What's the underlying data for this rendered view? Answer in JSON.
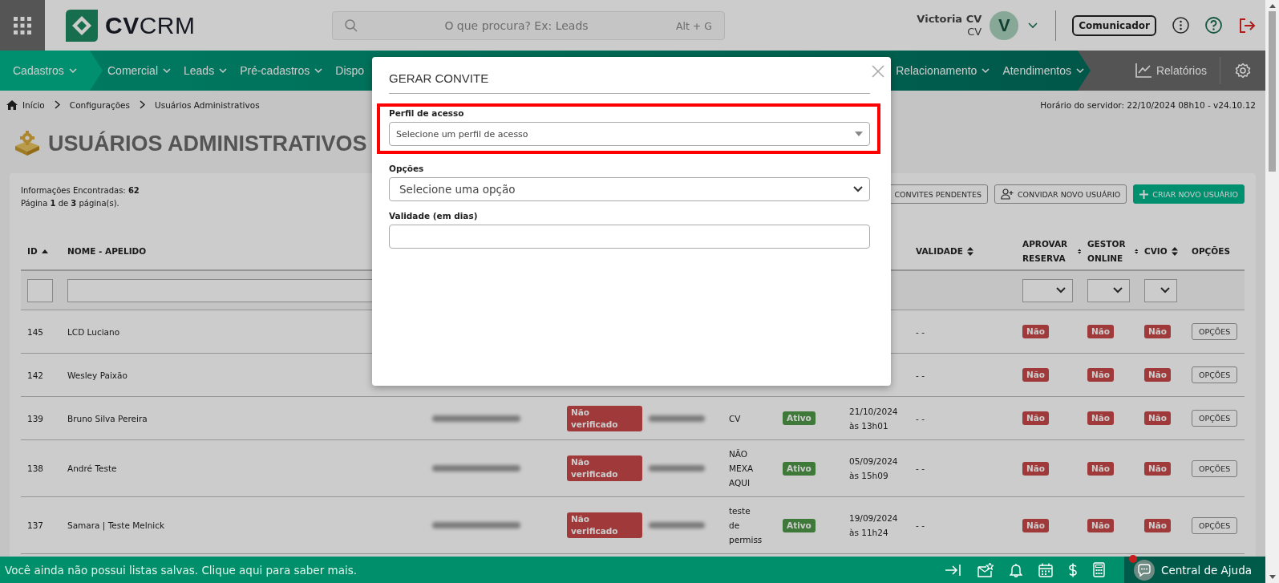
{
  "header": {
    "logo": "**CV**CRM",
    "search": {
      "placeholder": "O que procura? Ex: Leads",
      "shortcut": "Alt + G"
    },
    "user": {
      "name": "Victoria CV",
      "role": "CV",
      "initial": "V"
    },
    "communicator": "Comunicador"
  },
  "nav": {
    "primary": {
      "label": "Cadastros",
      "caret": true
    },
    "left_items": [
      {
        "label": "Comercial",
        "caret": true
      },
      {
        "label": "Leads",
        "caret": true
      },
      {
        "label": "Pré-cadastros",
        "caret": true
      },
      {
        "label": "Dispo",
        "caret": false
      }
    ],
    "right_items": [
      {
        "label": "Relacionamento",
        "caret": true
      },
      {
        "label": "Atendimentos",
        "caret": true
      }
    ],
    "reports": "Relatórios"
  },
  "breadcrumb": {
    "items": [
      "Início",
      "Configurações",
      "Usuários Administrativos"
    ],
    "server_time": "Horário do servidor: 22/10/2024 08h10 - v24.10.12"
  },
  "page_title": "USUÁRIOS ADMINISTRATIVOS",
  "summary": [
    "Informações Encontradas: **62**",
    "Página **1** de **3** página(s)."
  ],
  "actions": [
    {
      "label": "CONVITES PENDENTES",
      "kind": "plain"
    },
    {
      "label": "CONVIDAR NOVO USUÁRIO",
      "kind": "invite"
    },
    {
      "label": "CRIAR NOVO USUÁRIO",
      "kind": "create"
    }
  ],
  "table": {
    "columns": [
      {
        "label": "ID",
        "kind": "text-filter",
        "sortable": true,
        "sorted": true
      },
      {
        "label": "NOME - APELIDO",
        "kind": "text-filter",
        "sortable": false,
        "sorted": false
      },
      {
        "label": "VALIDADE",
        "kind": "no-filter",
        "sortable": true,
        "sorted": false
      },
      {
        "label": "APROVAR RESERVA",
        "kind": "select-filter",
        "sortable": true,
        "sorted": false
      },
      {
        "label": "GESTOR ONLINE",
        "kind": "select-filter",
        "sortable": true,
        "sorted": false
      },
      {
        "label": "CVIO",
        "kind": "select-filter",
        "sortable": true,
        "sorted": false
      },
      {
        "label": "OPÇÕES",
        "kind": "no-filter",
        "sortable": false,
        "sorted": false
      }
    ],
    "rows": [
      {
        "id": "145",
        "name": "LCD Luciano",
        "validity": "- -",
        "approve": "Não",
        "manager": "Não",
        "cvio": "Não",
        "action": "OPÇÕES"
      },
      {
        "id": "142",
        "name": "Wesley Paixão",
        "validity": "- -",
        "approve": "Não",
        "manager": "Não",
        "cvio": "Não",
        "action": "OPÇÕES"
      },
      {
        "id": "139",
        "name": "Bruno Silva Pereira",
        "email_blurred": true,
        "status": "Não verificado",
        "phone_blurred": true,
        "profile": "CV",
        "situation": "Ativo",
        "date": "21/10/2024",
        "time": "às 13h01",
        "validity": "- -",
        "approve": "Não",
        "manager": "Não",
        "cvio": "Não",
        "action": "OPÇÕES"
      },
      {
        "id": "138",
        "name": "André Teste",
        "email_blurred": true,
        "status": "Não verificado",
        "phone_blurred": true,
        "profile": "NÃO MEXA AQUI",
        "situation": "Ativo",
        "date": "05/09/2024",
        "time": "às 15h09",
        "validity": "- -",
        "approve": "Não",
        "manager": "Não",
        "cvio": "Não",
        "action": "OPÇÕES"
      },
      {
        "id": "137",
        "name": "Samara | Teste Melnick",
        "email_blurred": true,
        "status": "Não verificado",
        "phone_blurred": true,
        "profile": "teste de permiss",
        "situation": "Ativo",
        "date": "19/09/2024",
        "time": "às 11h24",
        "validity": "- -",
        "approve": "Não",
        "manager": "Não",
        "cvio": "Não",
        "action": "OPÇÕES"
      }
    ]
  },
  "modal": {
    "title": "GERAR CONVITE",
    "fields": [
      {
        "label": "Perfil de acesso",
        "kind": "select2",
        "placeholder": "Selecione um perfil de acesso",
        "highlighted": true
      },
      {
        "label": "Opções",
        "kind": "select",
        "placeholder": "Selecione uma opção",
        "highlighted": false
      },
      {
        "label": "Validade (em dias)",
        "kind": "input",
        "highlighted": false
      }
    ]
  },
  "bottom_bar": {
    "message": "Você ainda não possui listas salvas. Clique aqui para saber mais.",
    "help": "Central de Ajuda",
    "help_alert": true
  }
}
